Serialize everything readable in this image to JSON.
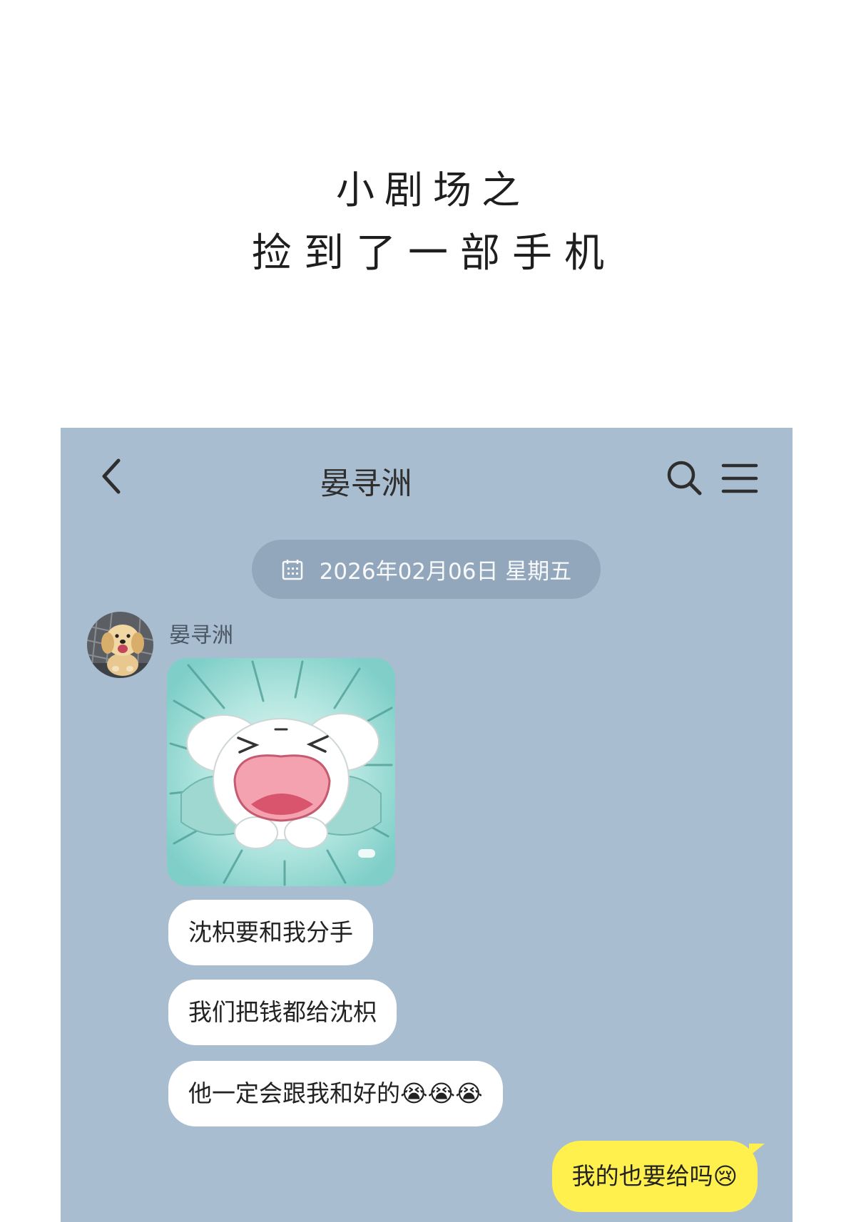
{
  "intro": {
    "line1": "小剧场之",
    "line2": "捡到了一部手机"
  },
  "chat": {
    "header": {
      "title": "晏寻洲",
      "back_icon": "chevron-left-icon",
      "search_icon": "search-icon",
      "menu_icon": "menu-icon"
    },
    "date_divider": {
      "icon": "calendar-icon",
      "text": "2026年02月06日 星期五"
    },
    "contact": {
      "name": "晏寻洲",
      "avatar": "puppy-photo-avatar"
    },
    "messages": [
      {
        "from": "contact",
        "type": "sticker",
        "sticker": "crying-puppy-sticker"
      },
      {
        "from": "contact",
        "type": "text",
        "text": "沈枳要和我分手"
      },
      {
        "from": "contact",
        "type": "text",
        "text": "我们把钱都给沈枳"
      },
      {
        "from": "contact",
        "type": "text",
        "text": "他一定会跟我和好的😭😭😭"
      },
      {
        "from": "me",
        "type": "text",
        "text": "我的也要给吗😢"
      }
    ]
  },
  "colors": {
    "chat_background": "#a9bdd1",
    "date_pill": "#93a7bc",
    "incoming_bubble": "#ffffff",
    "outgoing_bubble": "#fff04e",
    "text": "#222222"
  }
}
